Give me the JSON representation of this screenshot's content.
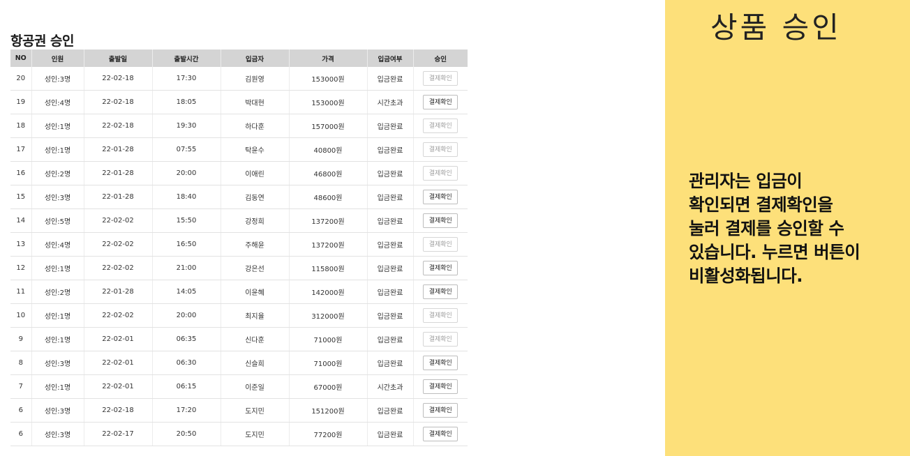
{
  "page": {
    "title": "항공권 승인"
  },
  "table": {
    "headers": [
      "NO",
      "인원",
      "출발일",
      "출발시간",
      "입금자",
      "가격",
      "입금여부",
      "승인"
    ],
    "rows": [
      {
        "no": "20",
        "people": "성인:3명",
        "date": "22-02-18",
        "time": "17:30",
        "payer": "김원영",
        "price": "153000원",
        "status": "입금완료",
        "action": "결제확인",
        "enabled": false
      },
      {
        "no": "19",
        "people": "성인:4명",
        "date": "22-02-18",
        "time": "18:05",
        "payer": "박대현",
        "price": "153000원",
        "status": "시간초과",
        "action": "결제확인",
        "enabled": true
      },
      {
        "no": "18",
        "people": "성인:1명",
        "date": "22-02-18",
        "time": "19:30",
        "payer": "하다훈",
        "price": "157000원",
        "status": "입금완료",
        "action": "결제확인",
        "enabled": false
      },
      {
        "no": "17",
        "people": "성인:1명",
        "date": "22-01-28",
        "time": "07:55",
        "payer": "탁윤수",
        "price": "40800원",
        "status": "입금완료",
        "action": "결제확인",
        "enabled": false
      },
      {
        "no": "16",
        "people": "성인:2명",
        "date": "22-01-28",
        "time": "20:00",
        "payer": "이애린",
        "price": "46800원",
        "status": "입금완료",
        "action": "결제확인",
        "enabled": false
      },
      {
        "no": "15",
        "people": "성인:3명",
        "date": "22-01-28",
        "time": "18:40",
        "payer": "김동연",
        "price": "48600원",
        "status": "입금완료",
        "action": "결제확인",
        "enabled": true
      },
      {
        "no": "14",
        "people": "성인:5명",
        "date": "22-02-02",
        "time": "15:50",
        "payer": "강정희",
        "price": "137200원",
        "status": "입금완료",
        "action": "결제확인",
        "enabled": true
      },
      {
        "no": "13",
        "people": "성인:4명",
        "date": "22-02-02",
        "time": "16:50",
        "payer": "주해윤",
        "price": "137200원",
        "status": "입금완료",
        "action": "결제확인",
        "enabled": false
      },
      {
        "no": "12",
        "people": "성인:1명",
        "date": "22-02-02",
        "time": "21:00",
        "payer": "강은선",
        "price": "115800원",
        "status": "입금완료",
        "action": "결제확인",
        "enabled": true
      },
      {
        "no": "11",
        "people": "성인:2명",
        "date": "22-01-28",
        "time": "14:05",
        "payer": "이윤혜",
        "price": "142000원",
        "status": "입금완료",
        "action": "결제확인",
        "enabled": true
      },
      {
        "no": "10",
        "people": "성인:1명",
        "date": "22-02-02",
        "time": "20:00",
        "payer": "최지율",
        "price": "312000원",
        "status": "입금완료",
        "action": "결제확인",
        "enabled": false
      },
      {
        "no": "9",
        "people": "성인:1명",
        "date": "22-02-01",
        "time": "06:35",
        "payer": "신다훈",
        "price": "71000원",
        "status": "입금완료",
        "action": "결제확인",
        "enabled": false
      },
      {
        "no": "8",
        "people": "성인:3명",
        "date": "22-02-01",
        "time": "06:30",
        "payer": "신슬희",
        "price": "71000원",
        "status": "입금완료",
        "action": "결제확인",
        "enabled": true
      },
      {
        "no": "7",
        "people": "성인:1명",
        "date": "22-02-01",
        "time": "06:15",
        "payer": "이준일",
        "price": "67000원",
        "status": "시간초과",
        "action": "결제확인",
        "enabled": true
      },
      {
        "no": "6",
        "people": "성인:3명",
        "date": "22-02-18",
        "time": "17:20",
        "payer": "도지민",
        "price": "151200원",
        "status": "입금완료",
        "action": "결제확인",
        "enabled": true
      },
      {
        "no": "6",
        "people": "성인:3명",
        "date": "22-02-17",
        "time": "20:50",
        "payer": "도지민",
        "price": "77200원",
        "status": "입금완료",
        "action": "결제확인",
        "enabled": true
      }
    ]
  },
  "side_panel": {
    "title": "상품 승인",
    "description": [
      "관리자는 입금이",
      "확인되면 결제확인을",
      "눌러 결제를 승인할 수",
      "있습니다. 누르면 버튼이",
      "비활성화됩니다."
    ],
    "background": "#fde07a"
  }
}
